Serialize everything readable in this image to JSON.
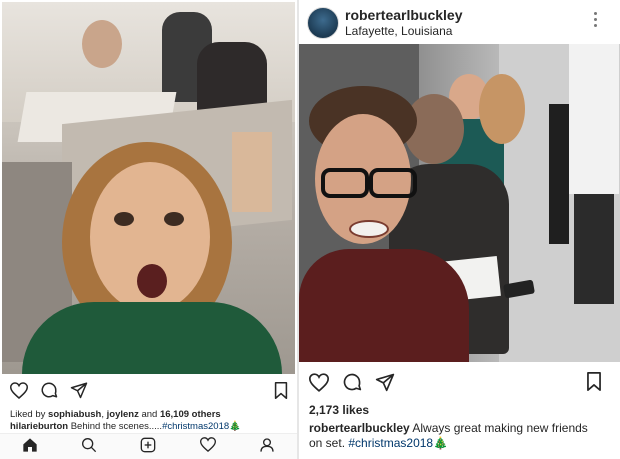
{
  "left_post": {
    "likes_prefix": "Liked by",
    "liked_by_1": "sophiabush",
    "liked_by_2": "joylenz",
    "likes_and": "and",
    "likes_count": "16,109 others",
    "caption_user": "hilarieburton",
    "caption_text": "Behind the scenes.....",
    "caption_hashtag": "#christmas2018",
    "caption_emoji": "🎄"
  },
  "right_post": {
    "username": "robertearlbuckley",
    "location": "Lafayette, Louisiana",
    "likes": "2,173 likes",
    "caption_user": "robertearlbuckley",
    "caption_line1": "Always great making new friends",
    "caption_line2": "on set.",
    "caption_hashtag": "#christmas2018",
    "caption_emoji": "🎄"
  },
  "icons": {
    "like": "heart-icon",
    "comment": "comment-icon",
    "share": "send-icon",
    "save": "bookmark-icon",
    "more": "more-options-icon",
    "nav": [
      "home-icon",
      "search-icon",
      "add-post-icon",
      "activity-heart-icon",
      "profile-icon"
    ]
  },
  "colors": {
    "text": "#262626",
    "hashtag": "#00376b",
    "divider": "#e6e6e6"
  }
}
